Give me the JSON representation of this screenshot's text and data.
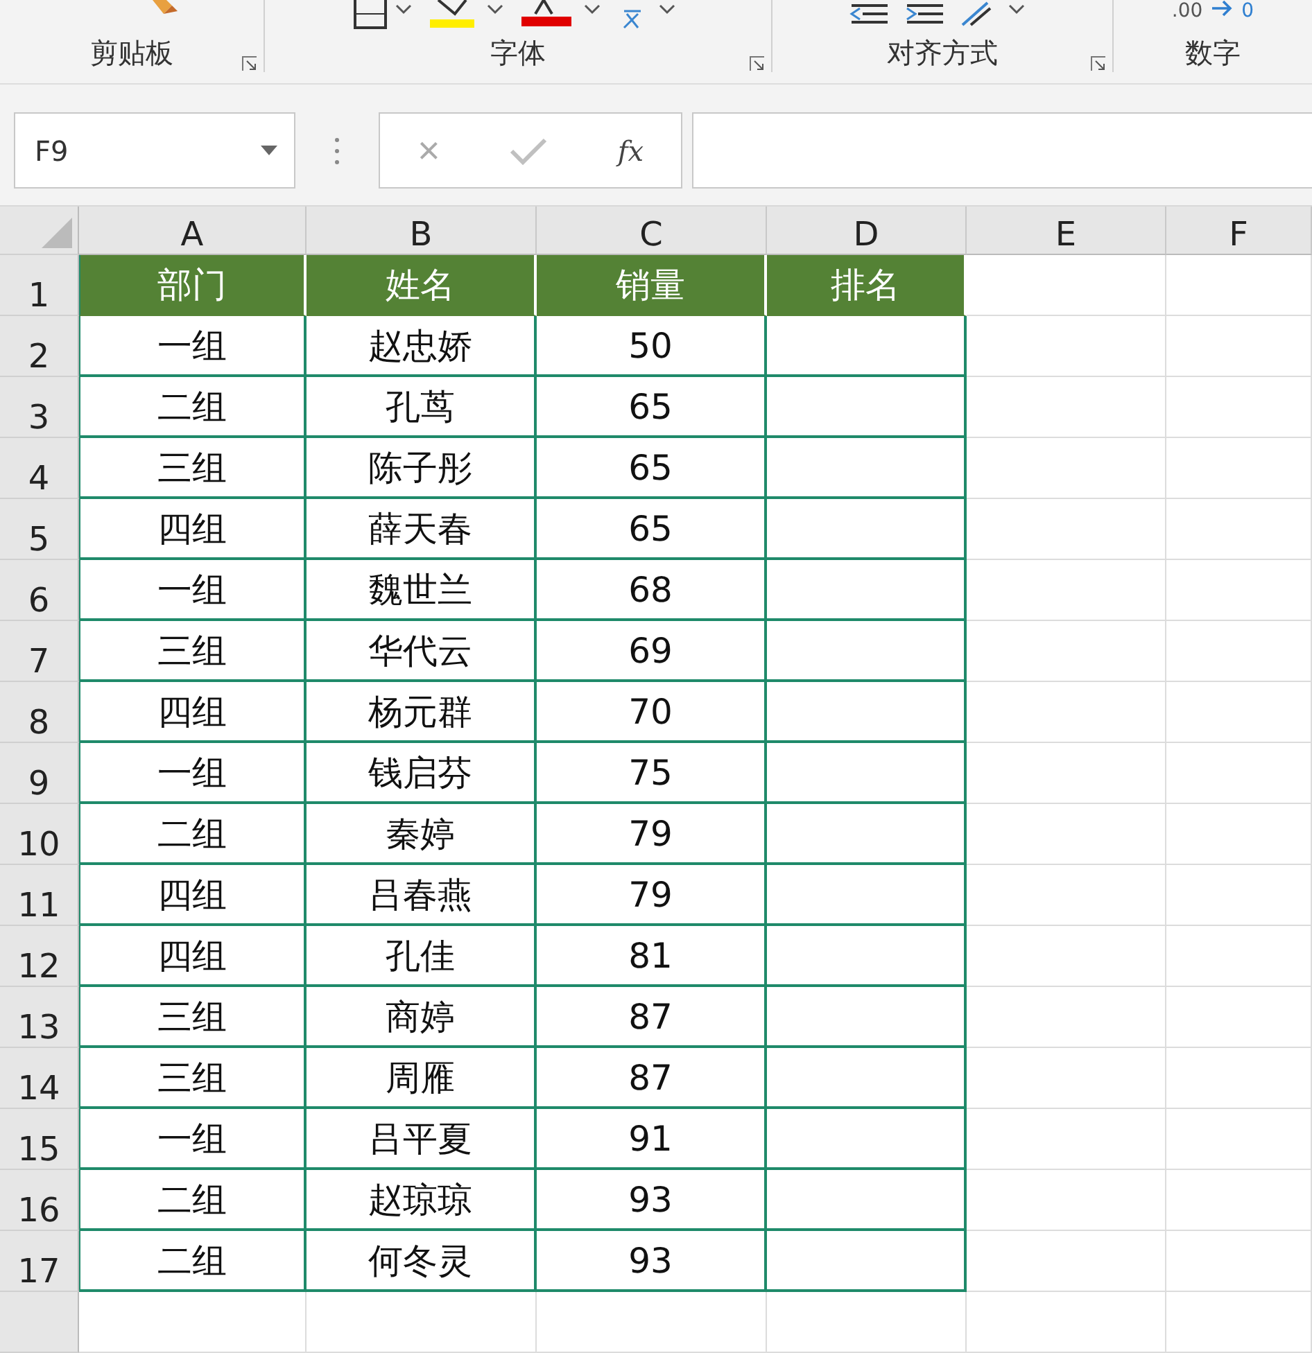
{
  "ribbon": {
    "groups": [
      {
        "label": "剪贴板",
        "launcher": true
      },
      {
        "label": "字体",
        "launcher": true
      },
      {
        "label": "对齐方式",
        "launcher": true
      },
      {
        "label": "数字",
        "launcher": false
      }
    ],
    "number_format": {
      "decimal": ".00",
      "shift": "0"
    }
  },
  "formula_bar": {
    "name_box": "F9",
    "cancel": "×",
    "fx": "fx"
  },
  "sheet": {
    "columns": [
      "A",
      "B",
      "C",
      "D",
      "E",
      "F"
    ],
    "rows": [
      {
        "row": "1",
        "cells": [
          "部门",
          "姓名",
          "销量",
          "排名"
        ]
      },
      {
        "row": "2",
        "cells": [
          "一组",
          "赵忠娇",
          "50",
          ""
        ]
      },
      {
        "row": "3",
        "cells": [
          "二组",
          "孔茑",
          "65",
          ""
        ]
      },
      {
        "row": "4",
        "cells": [
          "三组",
          "陈子彤",
          "65",
          ""
        ]
      },
      {
        "row": "5",
        "cells": [
          "四组",
          "薛天春",
          "65",
          ""
        ]
      },
      {
        "row": "6",
        "cells": [
          "一组",
          "魏世兰",
          "68",
          ""
        ]
      },
      {
        "row": "7",
        "cells": [
          "三组",
          "华代云",
          "69",
          ""
        ]
      },
      {
        "row": "8",
        "cells": [
          "四组",
          "杨元群",
          "70",
          ""
        ]
      },
      {
        "row": "9",
        "cells": [
          "一组",
          "钱启芬",
          "75",
          ""
        ]
      },
      {
        "row": "10",
        "cells": [
          "二组",
          "秦婷",
          "79",
          ""
        ]
      },
      {
        "row": "11",
        "cells": [
          "四组",
          "吕春燕",
          "79",
          ""
        ]
      },
      {
        "row": "12",
        "cells": [
          "四组",
          "孔佳",
          "81",
          ""
        ]
      },
      {
        "row": "13",
        "cells": [
          "三组",
          "商婷",
          "87",
          ""
        ]
      },
      {
        "row": "14",
        "cells": [
          "三组",
          "周雁",
          "87",
          ""
        ]
      },
      {
        "row": "15",
        "cells": [
          "一组",
          "吕平夏",
          "91",
          ""
        ]
      },
      {
        "row": "16",
        "cells": [
          "二组",
          "赵琼琼",
          "93",
          ""
        ]
      },
      {
        "row": "17",
        "cells": [
          "二组",
          "何冬灵",
          "93",
          ""
        ]
      }
    ]
  }
}
